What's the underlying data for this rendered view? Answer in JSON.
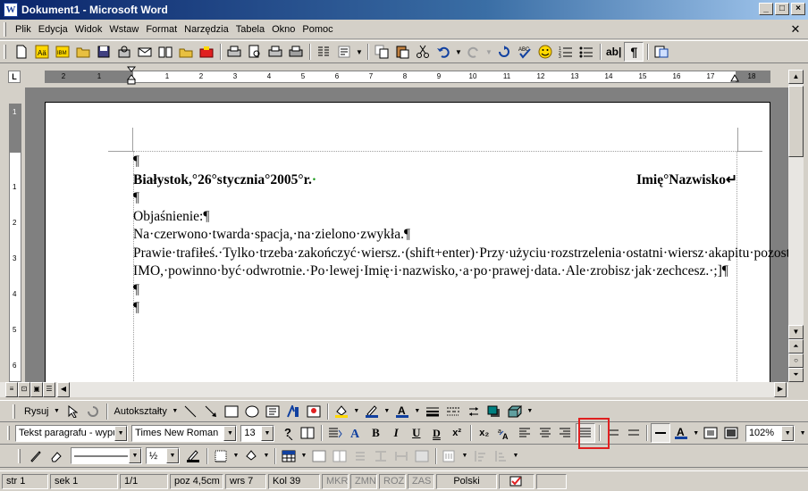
{
  "window": {
    "title": "Dokument1 - Microsoft Word",
    "minimize": "_",
    "maximize": "□",
    "close": "×"
  },
  "menu": [
    {
      "label": "Plik"
    },
    {
      "label": "Edycja"
    },
    {
      "label": "Widok"
    },
    {
      "label": "Wstaw"
    },
    {
      "label": "Format"
    },
    {
      "label": "Narzędzia"
    },
    {
      "label": "Tabela"
    },
    {
      "label": "Okno"
    },
    {
      "label": "Pomoc"
    }
  ],
  "standard_toolbar": {
    "show_hide_label": "¶",
    "ab_label": "ab|",
    "zoom_icon": "document-map-icon"
  },
  "ruler": {
    "corner_label": "L",
    "numbers": [
      "2",
      "1",
      "1",
      "1",
      "2",
      "3",
      "4",
      "5",
      "6",
      "7",
      "8",
      "9",
      "10",
      "11",
      "12",
      "13",
      "14",
      "15",
      "16",
      "17",
      "18"
    ]
  },
  "vertical_ruler": {
    "numbers": [
      "1",
      "1",
      "2",
      "3",
      "4",
      "5",
      "6"
    ]
  },
  "document": {
    "lines": [
      {
        "text": "¶",
        "bold": false
      },
      {
        "left": "Białystok,°26°stycznia°2005°r.",
        "right": "Imię°Nazwisko↵",
        "bold": true
      },
      {
        "text": "¶",
        "bold": false
      },
      {
        "text": "Objaśnienie:¶",
        "bold": false
      },
      {
        "text": "Na·czerwono·twarda·spacja,·na·zielono·zwykła.¶",
        "bold": false
      },
      {
        "text": "Prawie·trafiłeś.·Tylko·trzeba·zakończyć·wiersz.·(shift+enter)·Przy·użyciu·rozstrzelenia·ostatni·wiersz·akapitu·pozostaje·nienaruszony.¶",
        "bold": false,
        "justified": true
      },
      {
        "text": "IMO,·powinno·być·odwrotnie.·Po·lewej·Imię·i·nazwisko,·a·po·prawej·data.·Ale·zrobisz·jak·zechcesz.·;]¶",
        "bold": false,
        "justified": true
      },
      {
        "text": "¶",
        "bold": false
      },
      {
        "text": "¶",
        "bold": false
      }
    ]
  },
  "drawing_toolbar": {
    "draw_label": "Rysuj",
    "autoshapes_label": "Autokształty"
  },
  "formatting_toolbar": {
    "style": "Tekst paragrafu - wypu",
    "font": "Times New Roman",
    "size": "13",
    "zoom": "102%",
    "bold": "B",
    "italic": "I",
    "underline": "U",
    "double_underline": "D",
    "superscript": "x²",
    "subscript": "x₂"
  },
  "tables_toolbar": {
    "line_weight": "½"
  },
  "statusbar": {
    "page": "str 1",
    "section": "sek 1",
    "pages": "1/1",
    "position": "poz 4,5cm",
    "line": "wrs 7",
    "column": "Kol 39",
    "rec": "MKR",
    "trk": "ZMN",
    "ext": "ROZ",
    "ovr": "ZAS",
    "language": "Polski"
  },
  "colors": {
    "title_start": "#0a246a",
    "title_end": "#a6caf0",
    "chrome": "#d4d0c8",
    "workspace": "#808080",
    "highlight": "#e02020"
  }
}
